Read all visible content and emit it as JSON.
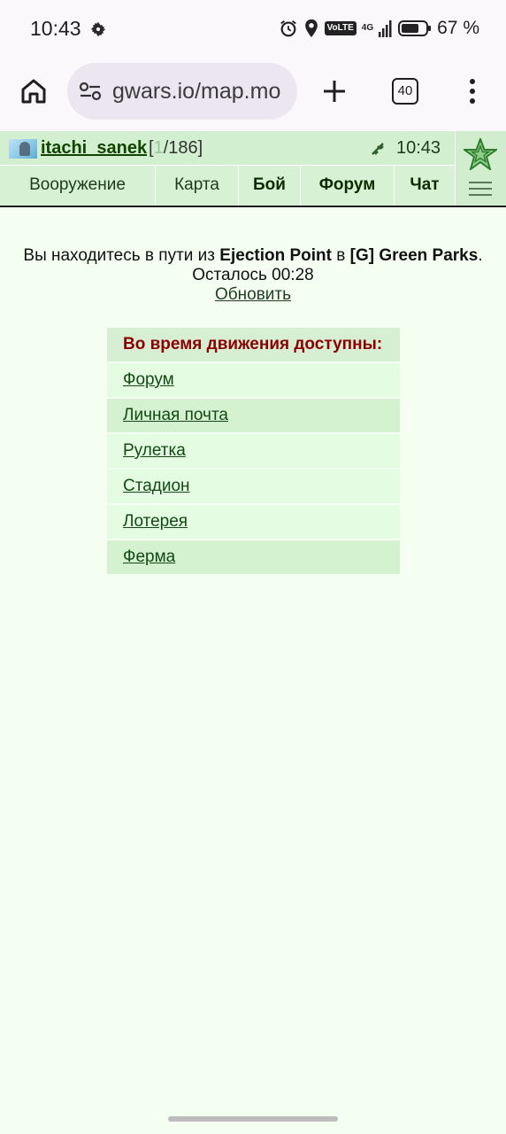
{
  "status_bar": {
    "time": "10:43",
    "volte": "VoLTE",
    "network": "4G",
    "battery": "67 %"
  },
  "browser": {
    "url": "gwars.io/map.mo",
    "tab_count": "40"
  },
  "header": {
    "username": "itachi_sanek",
    "level_open": "[",
    "level_current": "1",
    "level_rest": "/186]",
    "time": "10:43",
    "nav": [
      {
        "label": "Вооружение"
      },
      {
        "label": "Карта"
      },
      {
        "label": "Бой"
      },
      {
        "label": "Форум"
      },
      {
        "label": "Чат"
      }
    ]
  },
  "travel": {
    "prefix": "Вы находитесь в пути из ",
    "from": "Ejection Point",
    "middle": " в ",
    "to": "[G] Green Parks",
    "suffix": ".",
    "remaining": "Осталось 00:28",
    "refresh": "Обновить"
  },
  "actions": {
    "heading": "Во время движения доступны:",
    "items": [
      {
        "label": "Форум"
      },
      {
        "label": "Личная почта"
      },
      {
        "label": "Рулетка"
      },
      {
        "label": "Стадион"
      },
      {
        "label": "Лотерея"
      },
      {
        "label": "Ферма"
      }
    ]
  }
}
